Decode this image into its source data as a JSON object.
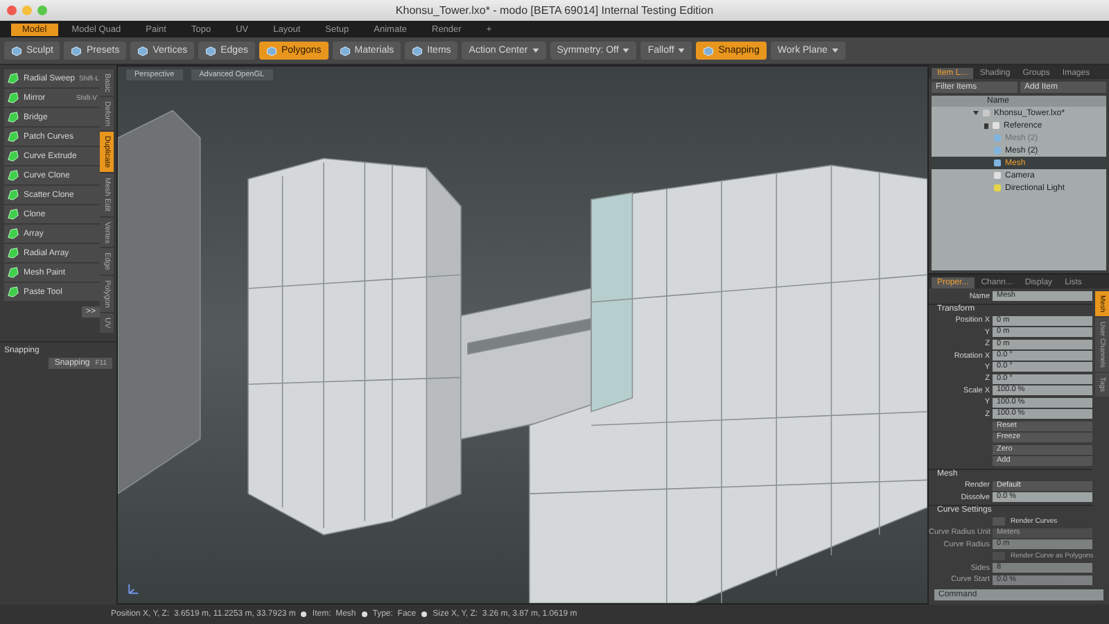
{
  "window": {
    "title": "Khonsu_Tower.lxo* - modo [BETA 69014] Internal Testing Edition"
  },
  "mode_tabs": [
    {
      "label": "Model",
      "selected": true
    },
    {
      "label": "Model Quad",
      "selected": false
    },
    {
      "label": "Paint",
      "selected": false
    },
    {
      "label": "Topo",
      "selected": false
    },
    {
      "label": "UV",
      "selected": false
    },
    {
      "label": "Layout",
      "selected": false
    },
    {
      "label": "Setup",
      "selected": false
    },
    {
      "label": "Animate",
      "selected": false
    },
    {
      "label": "Render",
      "selected": false
    },
    {
      "label": "+",
      "selected": false
    }
  ],
  "toolbar": [
    {
      "label": "Sculpt",
      "kind": "tool",
      "selected": false
    },
    {
      "label": "Presets",
      "kind": "tool",
      "selected": false
    },
    {
      "label": "Vertices",
      "kind": "tool",
      "selected": false
    },
    {
      "label": "Edges",
      "kind": "tool",
      "selected": false
    },
    {
      "label": "Polygons",
      "kind": "tool",
      "selected": true
    },
    {
      "label": "Materials",
      "kind": "tool",
      "selected": false
    },
    {
      "label": "Items",
      "kind": "tool",
      "selected": false
    },
    {
      "label": "Action Center",
      "kind": "dropdown",
      "selected": false
    },
    {
      "label": "Symmetry: Off",
      "kind": "dropdown",
      "selected": false
    },
    {
      "label": "Falloff",
      "kind": "dropdown",
      "selected": false
    },
    {
      "label": "Snapping",
      "kind": "tool",
      "selected": true
    },
    {
      "label": "Work Plane",
      "kind": "dropdown",
      "selected": false
    }
  ],
  "left_panel": {
    "tools": [
      {
        "label": "Radial Sweep",
        "shortcut": "Shift-L"
      },
      {
        "label": "Mirror",
        "shortcut": "Shift-V"
      },
      {
        "label": "Bridge"
      },
      {
        "label": "Patch Curves"
      },
      {
        "label": "Curve Extrude"
      },
      {
        "label": "Curve Clone"
      },
      {
        "label": "Scatter Clone"
      },
      {
        "label": "Clone"
      },
      {
        "label": "Array"
      },
      {
        "label": "Radial Array"
      },
      {
        "label": "Mesh Paint"
      },
      {
        "label": "Paste Tool"
      }
    ],
    "tabs": [
      {
        "label": "Basic",
        "selected": false
      },
      {
        "label": "Deform",
        "selected": false
      },
      {
        "label": "Duplicate",
        "selected": true
      },
      {
        "label": "Mesh Edit",
        "selected": false
      },
      {
        "label": "Vertex",
        "selected": false
      },
      {
        "label": "Edge",
        "selected": false
      },
      {
        "label": "Polygon",
        "selected": false
      },
      {
        "label": "UV",
        "selected": false
      }
    ],
    "more": ">>",
    "snapping": {
      "header": "Snapping",
      "label": "Snapping",
      "shortcut": "F11"
    }
  },
  "viewport": {
    "labels": [
      "Perspective",
      "Advanced OpenGL"
    ]
  },
  "items_panel": {
    "tabs": [
      {
        "label": "Item L...",
        "selected": true
      },
      {
        "label": "Shading",
        "selected": false
      },
      {
        "label": "Groups",
        "selected": false
      },
      {
        "label": "Images",
        "selected": false
      }
    ],
    "filter": "Filter Items",
    "add": "Add Item",
    "column": "Name",
    "tree": [
      {
        "label": "Khonsu_Tower.lxo*",
        "kind": "scene",
        "expanded": true,
        "selected": false,
        "disabled": false,
        "children": [
          {
            "label": "Reference",
            "kind": "group",
            "expanded": false,
            "selected": false,
            "disabled": false
          },
          {
            "label": "Mesh (2)",
            "kind": "mesh",
            "selected": false,
            "disabled": true
          },
          {
            "label": "Mesh (2)",
            "kind": "mesh",
            "selected": false,
            "disabled": false
          },
          {
            "label": "Mesh",
            "kind": "mesh",
            "selected": true,
            "disabled": false
          },
          {
            "label": "Camera",
            "kind": "camera",
            "selected": false,
            "disabled": false
          },
          {
            "label": "Directional Light",
            "kind": "light",
            "selected": false,
            "disabled": false
          }
        ]
      }
    ]
  },
  "properties": {
    "tabs": [
      {
        "label": "Proper...",
        "selected": true
      },
      {
        "label": "Chann...",
        "selected": false
      },
      {
        "label": "Display",
        "selected": false
      },
      {
        "label": "Lists",
        "selected": false
      }
    ],
    "name_label": "Name",
    "name": "Mesh",
    "side_tabs": [
      {
        "label": "Mesh",
        "selected": true
      },
      {
        "label": "User Channels",
        "selected": false
      },
      {
        "label": "Tags",
        "selected": false
      }
    ],
    "sections": [
      {
        "title": "Transform",
        "rows": [
          {
            "kind": "value",
            "label": "Position X",
            "value": "0 m",
            "disabled": false
          },
          {
            "kind": "value",
            "label": "Y",
            "value": "0 m",
            "disabled": false
          },
          {
            "kind": "value",
            "label": "Z",
            "value": "0 m",
            "disabled": false
          },
          {
            "kind": "value",
            "label": "Rotation X",
            "value": "0.0 °",
            "disabled": false
          },
          {
            "kind": "value",
            "label": "Y",
            "value": "0.0 °",
            "disabled": false
          },
          {
            "kind": "value",
            "label": "Z",
            "value": "0.0 °",
            "disabled": false
          },
          {
            "kind": "value",
            "label": "Scale X",
            "value": "100.0 %",
            "disabled": false
          },
          {
            "kind": "value",
            "label": "Y",
            "value": "100.0 %",
            "disabled": false
          },
          {
            "kind": "value",
            "label": "Z",
            "value": "100.0 %",
            "disabled": false
          },
          {
            "kind": "button",
            "value": "Reset",
            "disabled": false
          },
          {
            "kind": "button",
            "value": "Freeze",
            "disabled": false
          },
          {
            "kind": "button",
            "value": "Zero",
            "disabled": false
          },
          {
            "kind": "button",
            "value": "Add",
            "disabled": false
          }
        ]
      },
      {
        "title": "Mesh",
        "rows": [
          {
            "kind": "dropdown",
            "label": "Render",
            "value": "Default",
            "disabled": false
          },
          {
            "kind": "value",
            "label": "Dissolve",
            "value": "0.0 %",
            "disabled": false
          }
        ]
      },
      {
        "title": "Curve Settings",
        "rows": [
          {
            "kind": "checkbox",
            "label": "Render Curves",
            "checked": false,
            "disabled": false
          },
          {
            "kind": "dropdown",
            "label": "Curve Radius Unit",
            "value": "Meters",
            "disabled": true
          },
          {
            "kind": "value",
            "label": "Curve Radius",
            "value": "0 m",
            "disabled": true
          },
          {
            "kind": "checkbox",
            "label": "Render Curve as Polygons",
            "checked": false,
            "disabled": true
          },
          {
            "kind": "value",
            "label": "Sides",
            "value": "8",
            "disabled": true
          },
          {
            "kind": "value",
            "label": "Curve Start",
            "value": "0.0 %",
            "disabled": true
          }
        ]
      }
    ],
    "command_placeholder": "Command"
  },
  "status_bar": [
    "Position X, Y, Z:  3.6519 m, 11.2253 m, 33.7923 m",
    "Item:  Mesh",
    "Type:  Face",
    "Size X, Y, Z:  3.26 m, 3.87 m, 1.0619 m"
  ]
}
